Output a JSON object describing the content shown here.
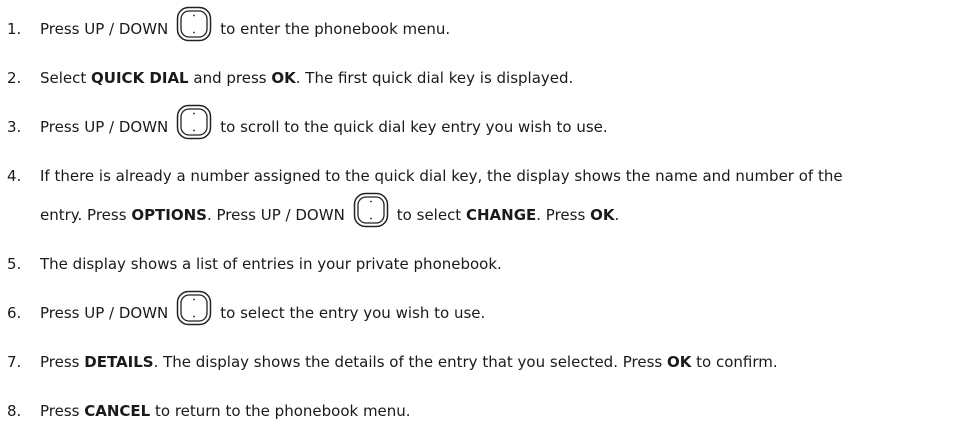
{
  "steps": [
    {
      "num": "1.",
      "parts": [
        {
          "t": "Press UP / DOWN"
        },
        {
          "icon": "navigation-key-icon"
        },
        {
          "t": "to enter the phonebook menu."
        }
      ]
    },
    {
      "num": "2.",
      "parts": [
        {
          "t": "Select "
        },
        {
          "b": "QUICK DIAL"
        },
        {
          "t": " and press "
        },
        {
          "b": "OK"
        },
        {
          "t": ". The first quick dial key is displayed."
        }
      ]
    },
    {
      "num": "3.",
      "parts": [
        {
          "t": "Press UP / DOWN"
        },
        {
          "icon": "navigation-key-icon"
        },
        {
          "t": "to scroll to the quick dial key entry you wish to use."
        }
      ]
    },
    {
      "num": "4.",
      "parts": [
        {
          "t": "If there is already a number assigned to the quick dial key, the display shows the name and number of the"
        }
      ]
    },
    {
      "num": "",
      "parts": [
        {
          "t": "entry. Press "
        },
        {
          "b": "OPTIONS"
        },
        {
          "t": ". Press UP / DOWN"
        },
        {
          "icon": "navigation-key-icon"
        },
        {
          "t": "to select "
        },
        {
          "b": "CHANGE"
        },
        {
          "t": ". Press "
        },
        {
          "b": "OK"
        },
        {
          "t": "."
        }
      ]
    },
    {
      "num": "5.",
      "parts": [
        {
          "t": "The display shows a list of entries in your private phonebook."
        }
      ]
    },
    {
      "num": "6.",
      "parts": [
        {
          "t": "Press UP / DOWN"
        },
        {
          "icon": "navigation-key-icon"
        },
        {
          "t": "to select the entry you wish to use."
        }
      ]
    },
    {
      "num": "7.",
      "parts": [
        {
          "t": "Press "
        },
        {
          "b": "DETAILS"
        },
        {
          "t": ". The display shows the details of the entry that you selected.  Press "
        },
        {
          "b": "OK"
        },
        {
          "t": " to confirm."
        }
      ]
    },
    {
      "num": "8.",
      "parts": [
        {
          "t": "Press "
        },
        {
          "b": "CANCEL"
        },
        {
          "t": " to return to the phonebook menu."
        }
      ]
    }
  ]
}
